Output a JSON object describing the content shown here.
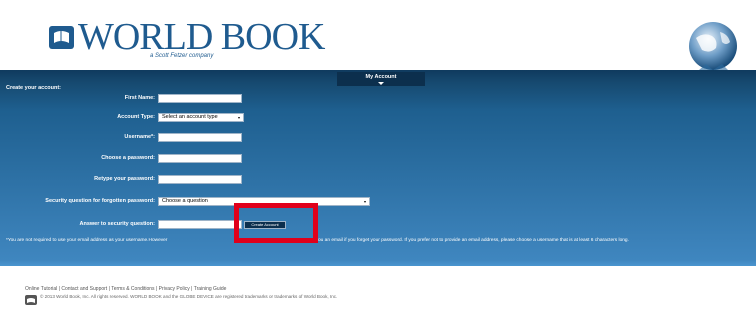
{
  "brand": {
    "logo_text": "WORLD BOOK",
    "tagline": "a Scott Fetzer company",
    "logo_icon": "world-book-logo-mark",
    "globe_icon": "globe-icon",
    "primary_color": "#1f5b8f"
  },
  "nav": {
    "tab_label": "My Account"
  },
  "form": {
    "title": "Create your account:",
    "fields": {
      "first_name": {
        "label": "First Name:",
        "value": ""
      },
      "account_type": {
        "label": "Account Type:",
        "value": "Select an account type"
      },
      "username": {
        "label": "Username*:",
        "value": ""
      },
      "password": {
        "label": "Choose a password:",
        "value": ""
      },
      "retype": {
        "label": "Retype your password:",
        "value": ""
      },
      "security_question": {
        "label": "Security question for forgotten password:",
        "value": "Choose a question"
      },
      "answer": {
        "label": "Answer to security question:",
        "value": ""
      }
    },
    "submit_label": "Create Account",
    "note_left": "*You are not required to use your email address as your username.However",
    "note_right": "ou an email if you forget your password. If you prefer not to provide an email address, please choose a username that is at least 6 characters long.",
    "highlight_color": "#e0001b"
  },
  "footer": {
    "links": [
      "Online Tutorial",
      "Contact and Support",
      "Terms & Conditions",
      "Privacy Policy",
      "Training Guide"
    ],
    "copyright": "© 2013 World Book, Inc. All rights reserved. WORLD BOOK and the GLOBE DEVICE are registered trademarks or trademarks of World Book, Inc."
  }
}
